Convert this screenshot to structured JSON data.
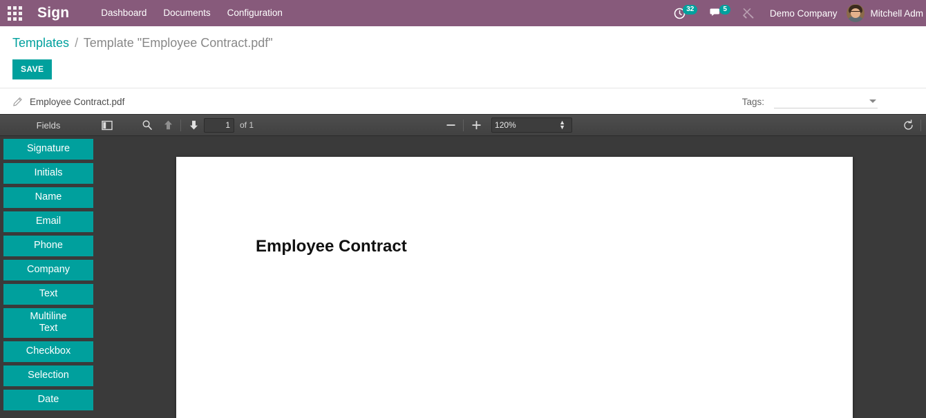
{
  "navbar": {
    "apps_icon": "apps-grid-icon",
    "brand": "Sign",
    "menu": [
      {
        "label": "Dashboard"
      },
      {
        "label": "Documents"
      },
      {
        "label": "Configuration"
      }
    ],
    "activities_icon": "clock-activity-icon",
    "activities_count": "32",
    "messages_icon": "messages-icon",
    "messages_count": "5",
    "tools_icon": "wrench-tools-icon",
    "company": "Demo Company",
    "avatar_icon": "user-avatar",
    "username": "Mitchell Adm"
  },
  "control_panel": {
    "breadcrumb_root": "Templates",
    "breadcrumb_separator": "/",
    "breadcrumb_current": "Template \"Employee Contract.pdf\"",
    "save_label": "SAVE"
  },
  "document": {
    "edit_icon": "pencil-icon",
    "filename": "Employee Contract.pdf",
    "tags_label": "Tags:",
    "tags_value": "",
    "tags_placeholder": "",
    "tags_caret_icon": "chevron-down-icon"
  },
  "pdf_toolbar": {
    "fields_label": "Fields",
    "sidebar_toggle_icon": "sidebar-toggle-icon",
    "search_icon": "search-icon",
    "prev_icon": "arrow-up-icon",
    "next_icon": "arrow-down-icon",
    "page_number": "1",
    "page_total": "of 1",
    "zoom_out_icon": "minus-icon",
    "zoom_in_icon": "plus-icon",
    "zoom_level": "120%",
    "zoom_options": [
      "120%"
    ],
    "rotate_icon": "rotate-icon"
  },
  "fields": [
    {
      "label": "Signature"
    },
    {
      "label": "Initials"
    },
    {
      "label": "Name"
    },
    {
      "label": "Email"
    },
    {
      "label": "Phone"
    },
    {
      "label": "Company"
    },
    {
      "label": "Text"
    },
    {
      "label": "Multiline Text"
    },
    {
      "label": "Checkbox"
    },
    {
      "label": "Selection"
    },
    {
      "label": "Date"
    }
  ],
  "pdf_page": {
    "title": "Employee Contract"
  },
  "colors": {
    "brand_purple": "#875A7B",
    "accent_teal": "#00A09D",
    "toolbar_dark": "#474747",
    "viewer_bg": "#3a3a3a"
  }
}
